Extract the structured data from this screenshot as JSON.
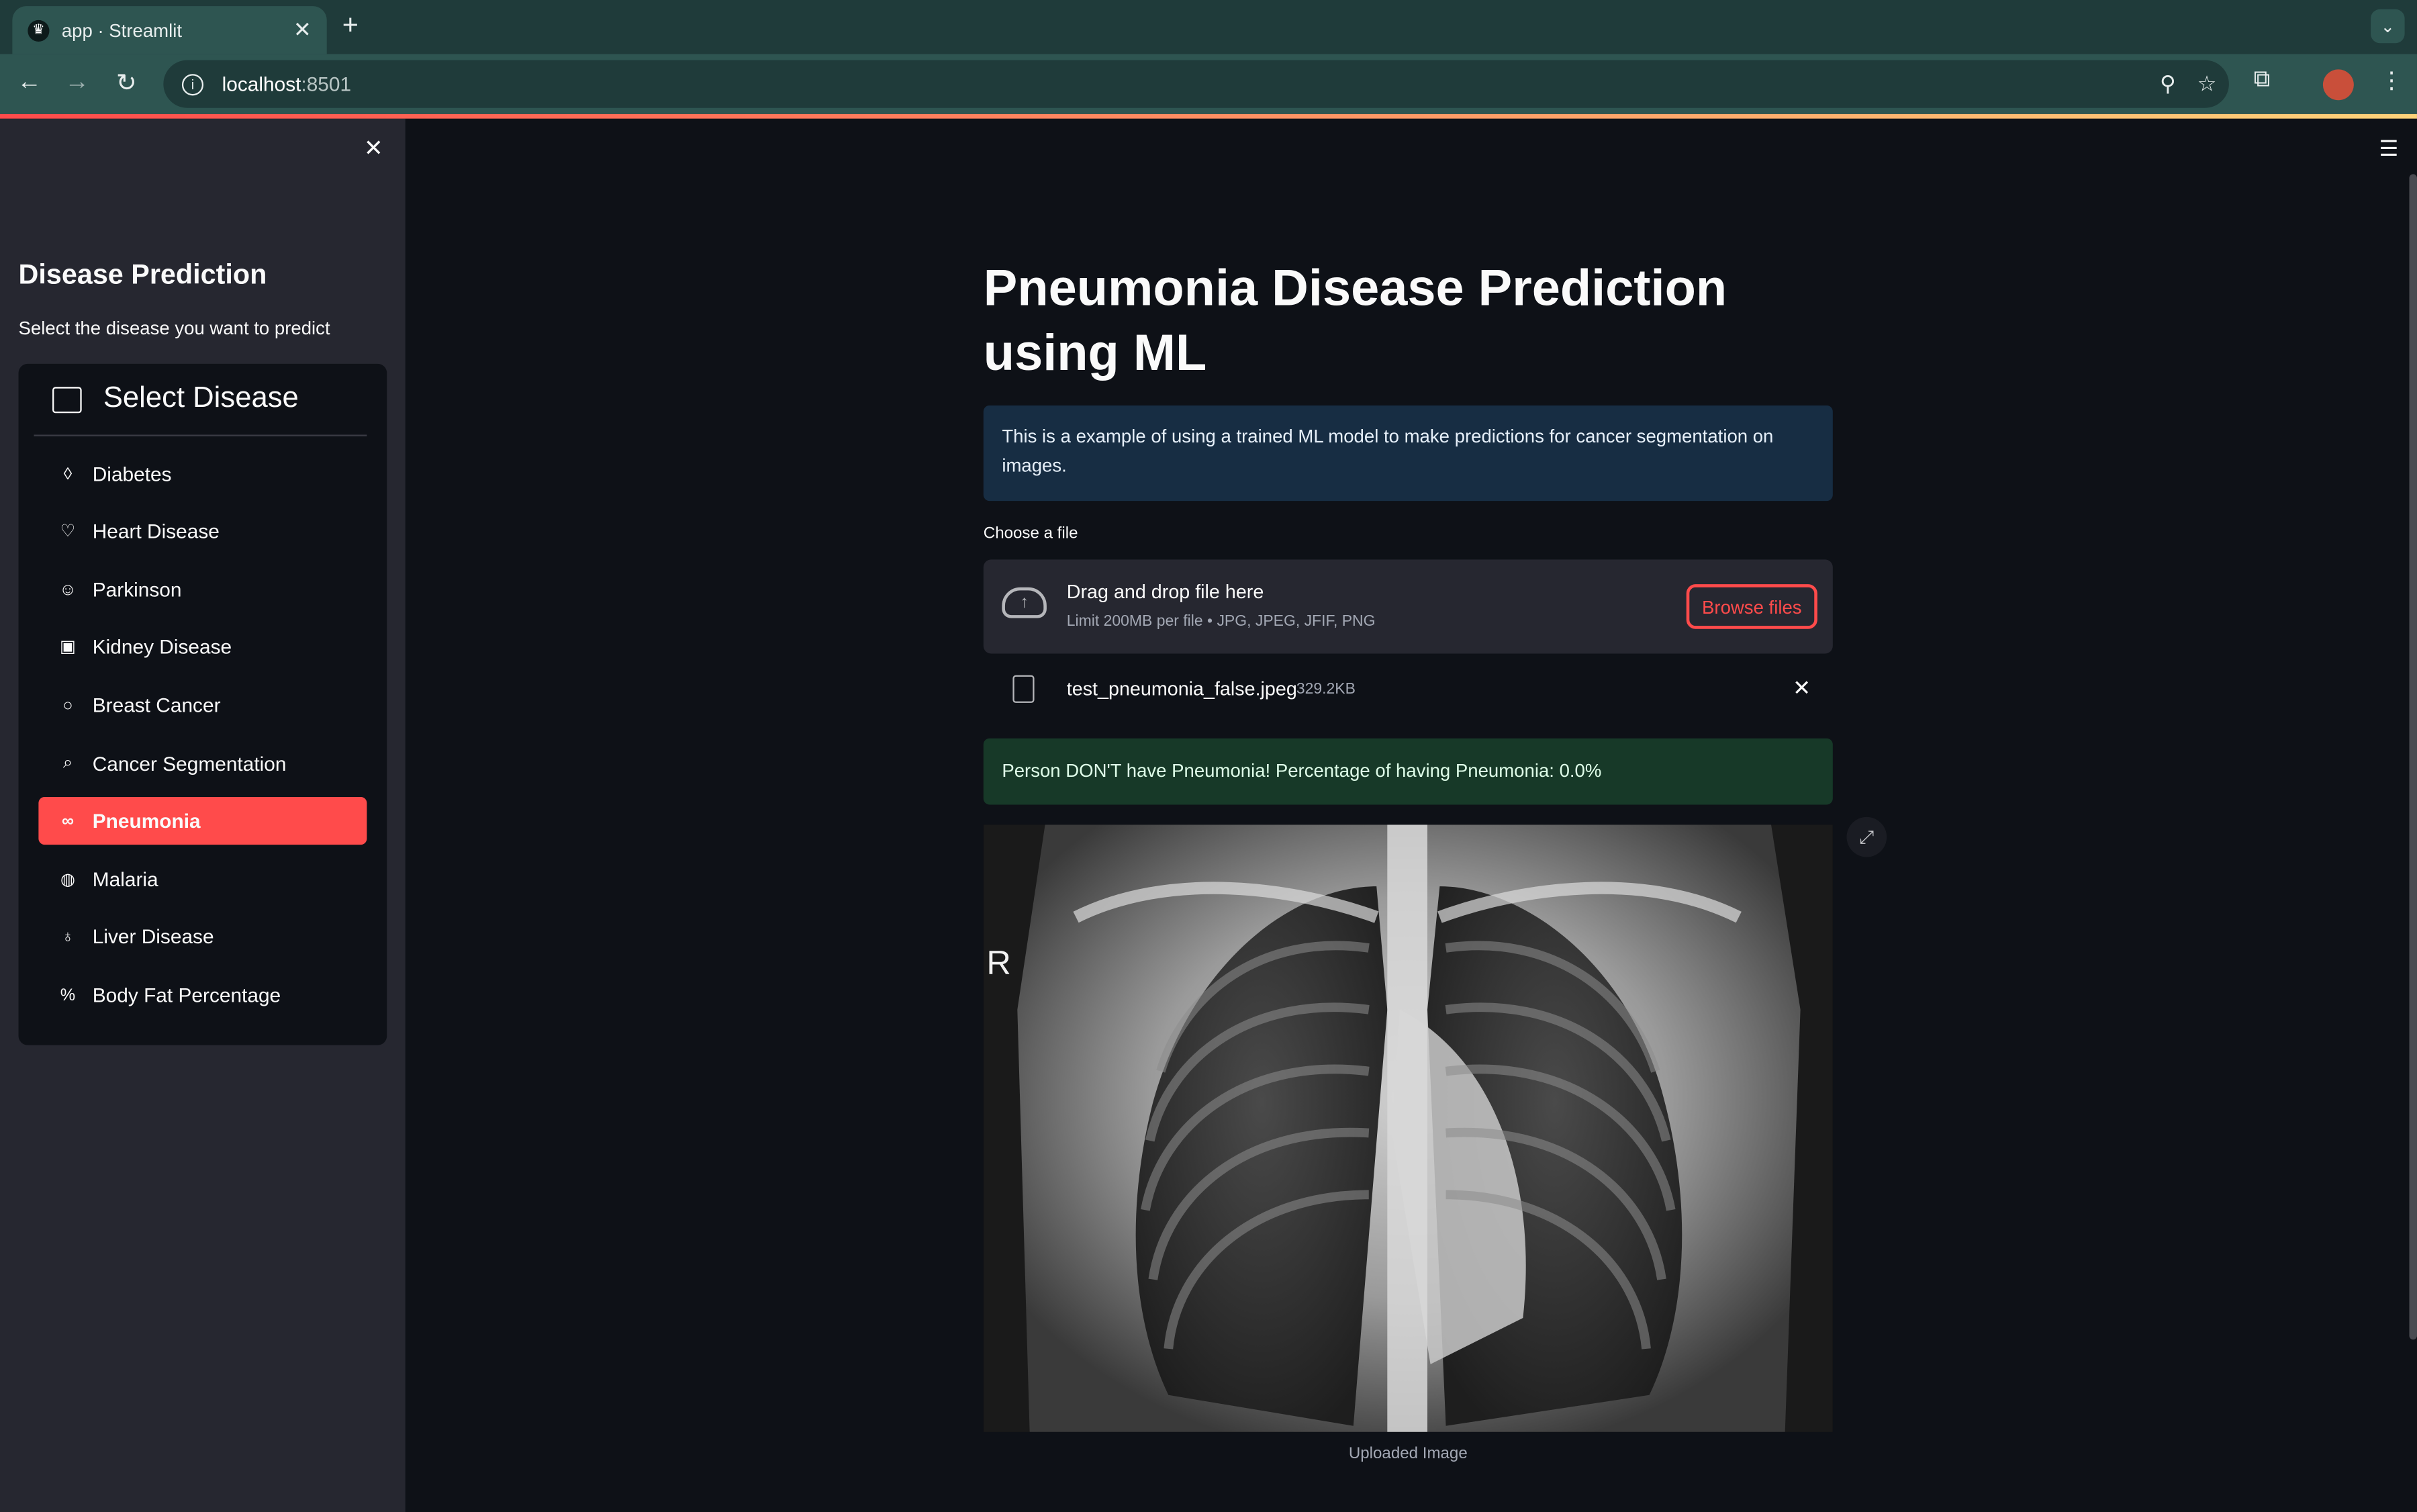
{
  "browser": {
    "tab_title": "app · Streamlit",
    "url_host": "localhost",
    "url_port": ":8501"
  },
  "sidebar": {
    "title": "Disease Prediction",
    "subtitle": "Select the disease you want to predict",
    "menu_title": "Select Disease",
    "items": [
      {
        "label": "Diabetes",
        "icon": "droplet-icon",
        "glyph": "◊"
      },
      {
        "label": "Heart Disease",
        "icon": "heart-icon",
        "glyph": "♡"
      },
      {
        "label": "Parkinson",
        "icon": "person-icon",
        "glyph": "☺"
      },
      {
        "label": "Kidney Disease",
        "icon": "clipboard-icon",
        "glyph": "▣"
      },
      {
        "label": "Breast Cancer",
        "icon": "award-icon",
        "glyph": "○"
      },
      {
        "label": "Cancer Segmentation",
        "icon": "search-icon",
        "glyph": "⌕"
      },
      {
        "label": "Pneumonia",
        "icon": "lungs-icon",
        "glyph": "∞",
        "active": true
      },
      {
        "label": "Malaria",
        "icon": "globe-icon",
        "glyph": "◍"
      },
      {
        "label": "Liver Disease",
        "icon": "body-icon",
        "glyph": "♁"
      },
      {
        "label": "Body Fat Percentage",
        "icon": "percent-icon",
        "glyph": "%"
      }
    ]
  },
  "main": {
    "title": "Pneumonia Disease Prediction using ML",
    "info": "This is a example of using a trained ML model to make predictions for cancer segmentation on images.",
    "uploader": {
      "label": "Choose a file",
      "drag_text": "Drag and drop file here",
      "limit_text": "Limit 200MB per file • JPG, JPEG, JFIF, PNG",
      "browse_label": "Browse files"
    },
    "file": {
      "name": "test_pneumonia_false.jpeg",
      "size": "329.2KB"
    },
    "result": "Person DON'T have Pneumonia! Percentage of having Pneumonia: 0.0%",
    "image_marker": "R",
    "caption": "Uploaded Image"
  },
  "colors": {
    "accent": "#ff4b4b",
    "sidebar_bg": "#262730",
    "main_bg": "#0e1117",
    "info_bg": "#172d43",
    "success_bg": "#173928"
  }
}
